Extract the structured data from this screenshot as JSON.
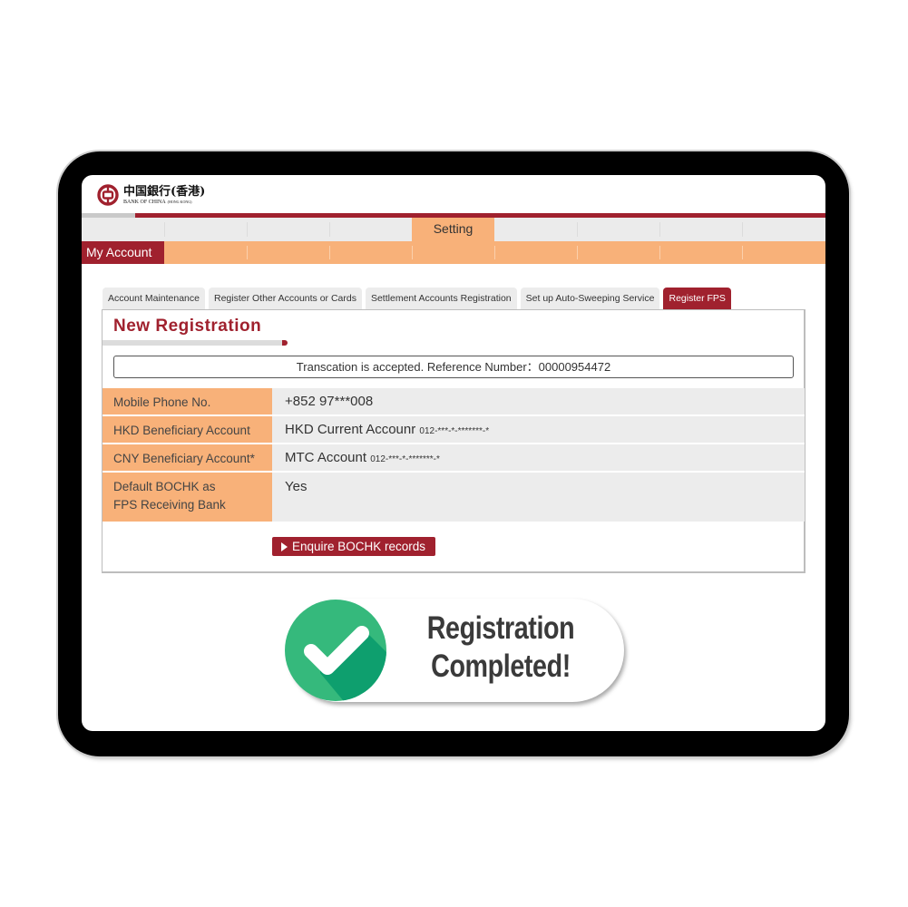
{
  "brand": {
    "name_cn": "中国銀行(香港)",
    "name_en": "BANK OF CHINA",
    "name_en_suffix": "(HONG KONG)",
    "primary_color": "#a0212e",
    "accent_color": "#f8b179"
  },
  "nav": {
    "main_active": "My Account",
    "sub_active": "Setting"
  },
  "tabs": [
    {
      "label": "Account Maintenance",
      "active": false
    },
    {
      "label": "Register Other Accounts or Cards",
      "active": false
    },
    {
      "label": "Settlement Accounts Registration",
      "active": false
    },
    {
      "label": "Set up Auto-Sweeping Service",
      "active": false
    },
    {
      "label": "Register FPS",
      "active": true
    }
  ],
  "section": {
    "title": "New Registration",
    "notice": "Transcation is accepted. Reference Number：00000954472"
  },
  "details": [
    {
      "label": "Mobile Phone No.",
      "value": "+852 97***008",
      "suffix": ""
    },
    {
      "label": "HKD Beneficiary Account",
      "value": "HKD Current Accounr ",
      "suffix": "012-***-*-*******-*"
    },
    {
      "label": "CNY Beneficiary Account*",
      "value": "MTC Account ",
      "suffix": "012-***-*-*******-*"
    },
    {
      "label": "Default BOCHK as FPS Receiving Bank",
      "label_line1": "Default BOCHK as",
      "label_line2": "FPS Receiving Bank",
      "value": "Yes",
      "suffix": ""
    }
  ],
  "actions": {
    "enquire_label": "Enquire BOCHK records"
  },
  "badge": {
    "line1": "Registration",
    "line2": "Completed!",
    "icon": "check-circle-icon",
    "icon_color": "#35b97c",
    "icon_shadow_color": "#0e9f6e"
  }
}
